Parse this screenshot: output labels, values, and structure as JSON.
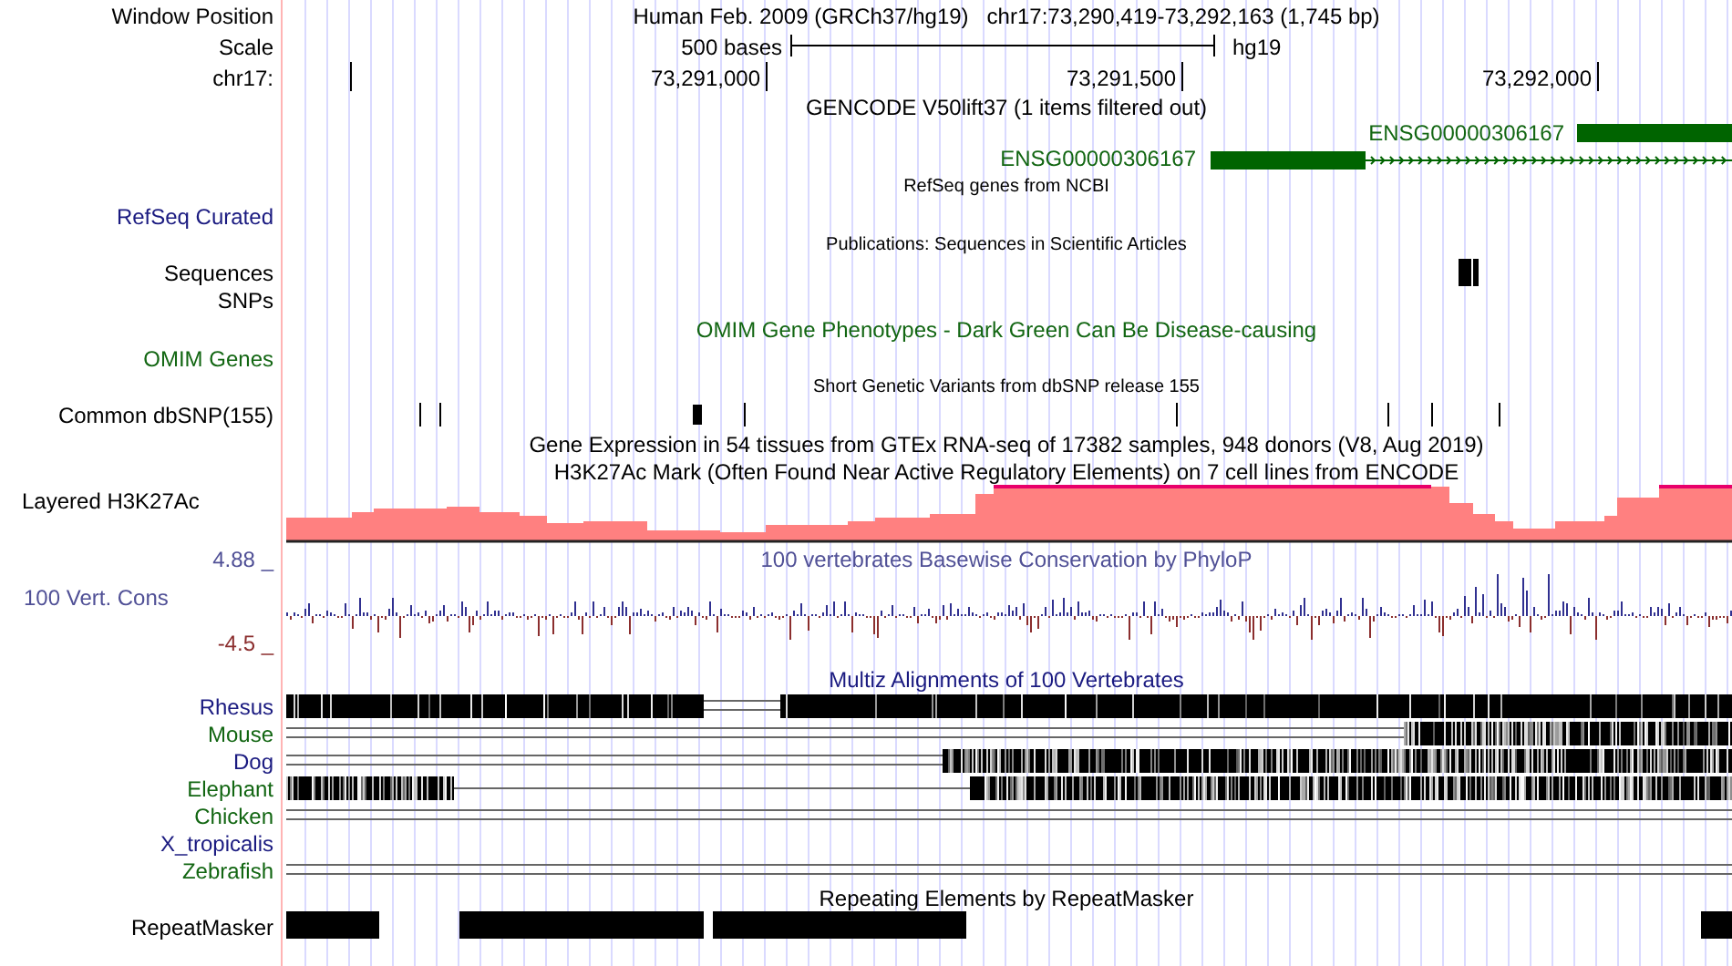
{
  "header": {
    "label": "Window Position",
    "title": "Human Feb. 2009 (GRCh37/hg19)",
    "position": "chr17:73,290,419-73,292,163 (1,745 bp)"
  },
  "scale": {
    "label": "Scale",
    "length": "500 bases",
    "assembly": "hg19"
  },
  "ruler": {
    "label": "chr17:",
    "ticks": [
      "73,291,000",
      "73,291,500",
      "73,292,000"
    ]
  },
  "tracks": [
    {
      "kind": "genes",
      "title": "GENCODE V50lift37 (1 items filtered out)",
      "genes": [
        "ENSG00000306167",
        "ENSG00000306167"
      ]
    },
    {
      "kind": "refseq",
      "title": "RefSeq genes from NCBI",
      "label": "RefSeq Curated"
    },
    {
      "kind": "publications",
      "title": "Publications: Sequences in Scientific Articles",
      "labels": [
        "Sequences",
        "SNPs"
      ]
    },
    {
      "kind": "omim",
      "title": "OMIM Gene Phenotypes - Dark Green Can Be Disease-causing",
      "label": "OMIM Genes"
    },
    {
      "kind": "snps",
      "title": "Short Genetic Variants from dbSNP release 155",
      "label": "Common dbSNP(155)"
    },
    {
      "kind": "expression",
      "title": "Gene Expression in 54 tissues from GTEx RNA-seq of 17382 samples, 948 donors (V8, Aug 2019)"
    },
    {
      "kind": "signal",
      "title": "H3K27Ac Mark (Often Found Near Active Regulatory Elements) on 7 cell lines from ENCODE",
      "label": "Layered H3K27Ac"
    },
    {
      "kind": "conservation",
      "title": "100 vertebrates Basewise Conservation by PhyloP",
      "label": "100 Vert. Cons",
      "max": "4.88 _",
      "min": "-4.5 _"
    },
    {
      "kind": "alignment",
      "title": "Multiz Alignments of 100 Vertebrates",
      "species": [
        {
          "name": "Rhesus",
          "color": "#1a1a80"
        },
        {
          "name": "Mouse",
          "color": "#126612"
        },
        {
          "name": "Dog",
          "color": "#1a1a80"
        },
        {
          "name": "Elephant",
          "color": "#126612"
        },
        {
          "name": "Chicken",
          "color": "#126612"
        },
        {
          "name": "X_tropicalis",
          "color": "#1a1a80"
        },
        {
          "name": "Zebrafish",
          "color": "#126612"
        }
      ]
    },
    {
      "kind": "repeats",
      "title": "Repeating Elements by RepeatMasker",
      "label": "RepeatMasker"
    }
  ]
}
